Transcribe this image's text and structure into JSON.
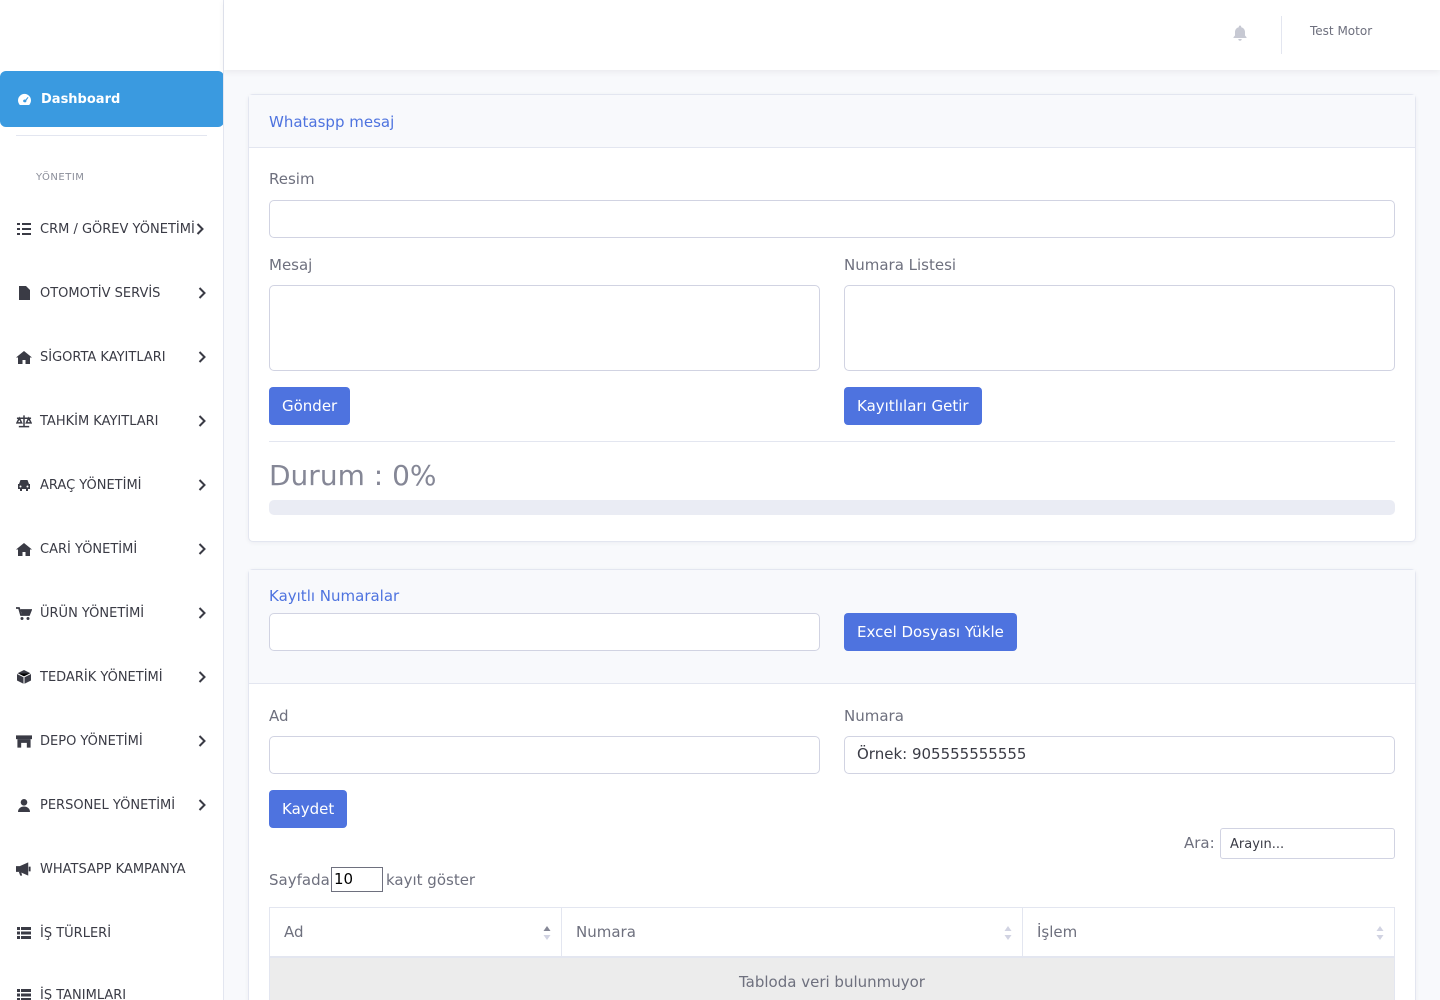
{
  "sidebar": {
    "dashboard": "Dashboard",
    "heading": "YÖNETIM",
    "items": [
      {
        "label": "CRM / GÖREV YÖNETİMİ",
        "icon": "tasks-icon",
        "chevron": true
      },
      {
        "label": "OTOMOTİV SERVİS",
        "icon": "file-icon",
        "chevron": true
      },
      {
        "label": "SİGORTA KAYITLARI",
        "icon": "home-icon",
        "chevron": true
      },
      {
        "label": "TAHKİM KAYITLARI",
        "icon": "balance-scale-icon",
        "chevron": true
      },
      {
        "label": "ARAÇ YÖNETİMİ",
        "icon": "car-icon",
        "chevron": true
      },
      {
        "label": "CARİ YÖNETİMİ",
        "icon": "home-icon",
        "chevron": true
      },
      {
        "label": "ÜRÜN YÖNETİMİ",
        "icon": "cart-icon",
        "chevron": true
      },
      {
        "label": "TEDARİK YÖNETİMİ",
        "icon": "box-icon",
        "chevron": true
      },
      {
        "label": "DEPO YÖNETİMİ",
        "icon": "store-icon",
        "chevron": true
      },
      {
        "label": "PERSONEL YÖNETİMİ",
        "icon": "user-icon",
        "chevron": true
      },
      {
        "label": "WHATSAPP KAMPANYA",
        "icon": "megaphone-icon",
        "chevron": false
      },
      {
        "label": "İŞ TÜRLERİ",
        "icon": "list-icon",
        "chevron": false
      },
      {
        "label": "İŞ TANIMLARI",
        "icon": "list-icon",
        "chevron": false
      }
    ]
  },
  "topbar": {
    "user": "Test Motor",
    "bell_icon": "bell-icon"
  },
  "message_card": {
    "title": "Whataspp mesaj",
    "image_label": "Resim",
    "message_label": "Mesaj",
    "numbers_label": "Numara Listesi",
    "send_button": "Gönder",
    "fetch_button": "Kayıtlıları Getir",
    "status_text": "Durum : 0%",
    "progress": 0
  },
  "saved_card": {
    "title": "Kayıtlı Numaralar",
    "excel_button": "Excel Dosyası Yükle",
    "name_label": "Ad",
    "number_label": "Numara",
    "number_placeholder": "Örnek: 905555555555",
    "save_button": "Kaydet",
    "search_label": "Ara:",
    "search_placeholder": "Arayın...",
    "page_prefix": "Sayfada",
    "page_size": "10",
    "page_suffix": "kayıt göster",
    "columns": [
      "Ad",
      "Numara",
      "İşlem"
    ],
    "empty_text": "Tabloda veri bulunmuyor"
  },
  "colors": {
    "primary": "#4e73df",
    "sidebar_active": "#3a9ae0"
  }
}
